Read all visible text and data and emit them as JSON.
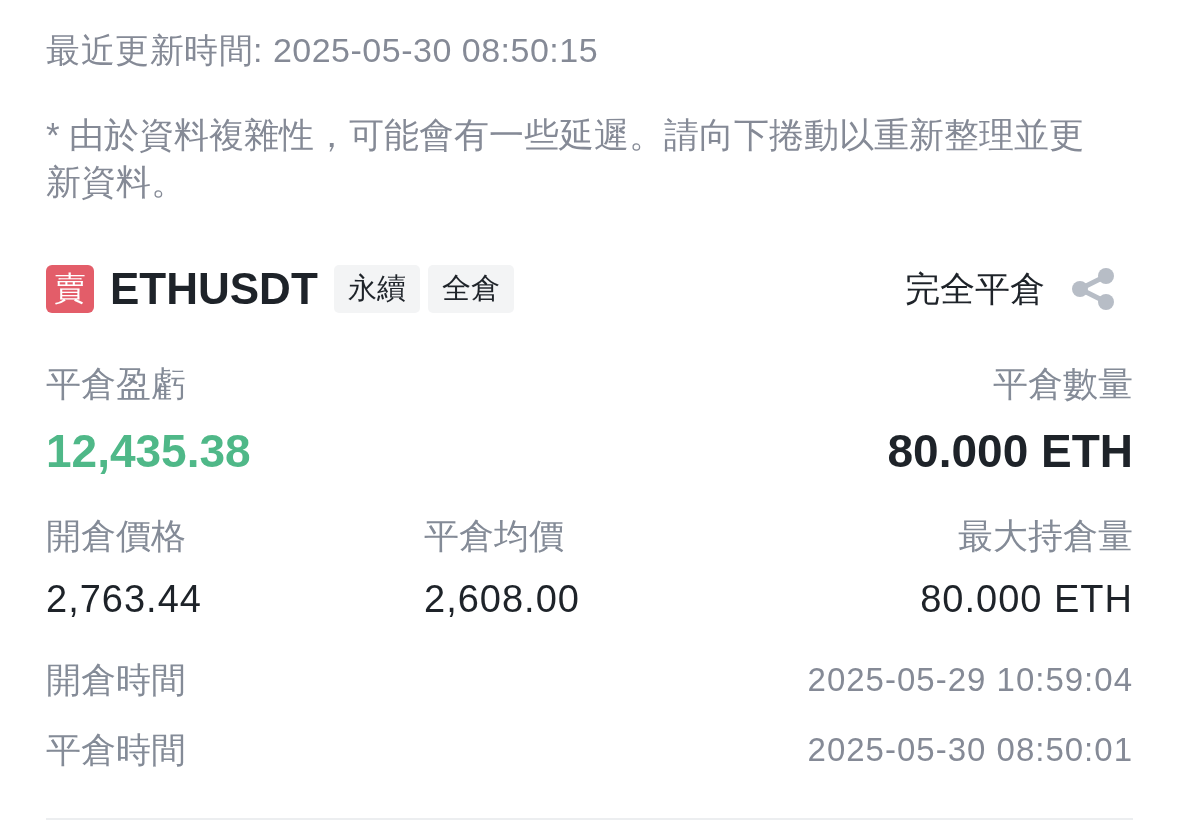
{
  "last_updated": "最近更新時間: 2025-05-30 08:50:15",
  "notice": "* 由於資料複雜性，可能會有一些延遲。請向下捲動以重新整理並更新資料。",
  "position": {
    "side_badge": "賣",
    "symbol": "ETHUSDT",
    "tags": [
      "永續",
      "全倉"
    ],
    "close_all_button": "完全平倉"
  },
  "pnl": {
    "label": "平倉盈虧",
    "value": "12,435.38",
    "positive": true
  },
  "closed_quantity": {
    "label": "平倉數量",
    "value": "80.000 ETH"
  },
  "prices": [
    {
      "label": "開倉價格",
      "value": "2,763.44"
    },
    {
      "label": "平倉均價",
      "value": "2,608.00"
    },
    {
      "label": "最大持倉量",
      "value": "80.000 ETH"
    }
  ],
  "times": [
    {
      "label": "開倉時間",
      "value": "2025-05-29 10:59:04"
    },
    {
      "label": "平倉時間",
      "value": "2025-05-30 08:50:01"
    }
  ]
}
